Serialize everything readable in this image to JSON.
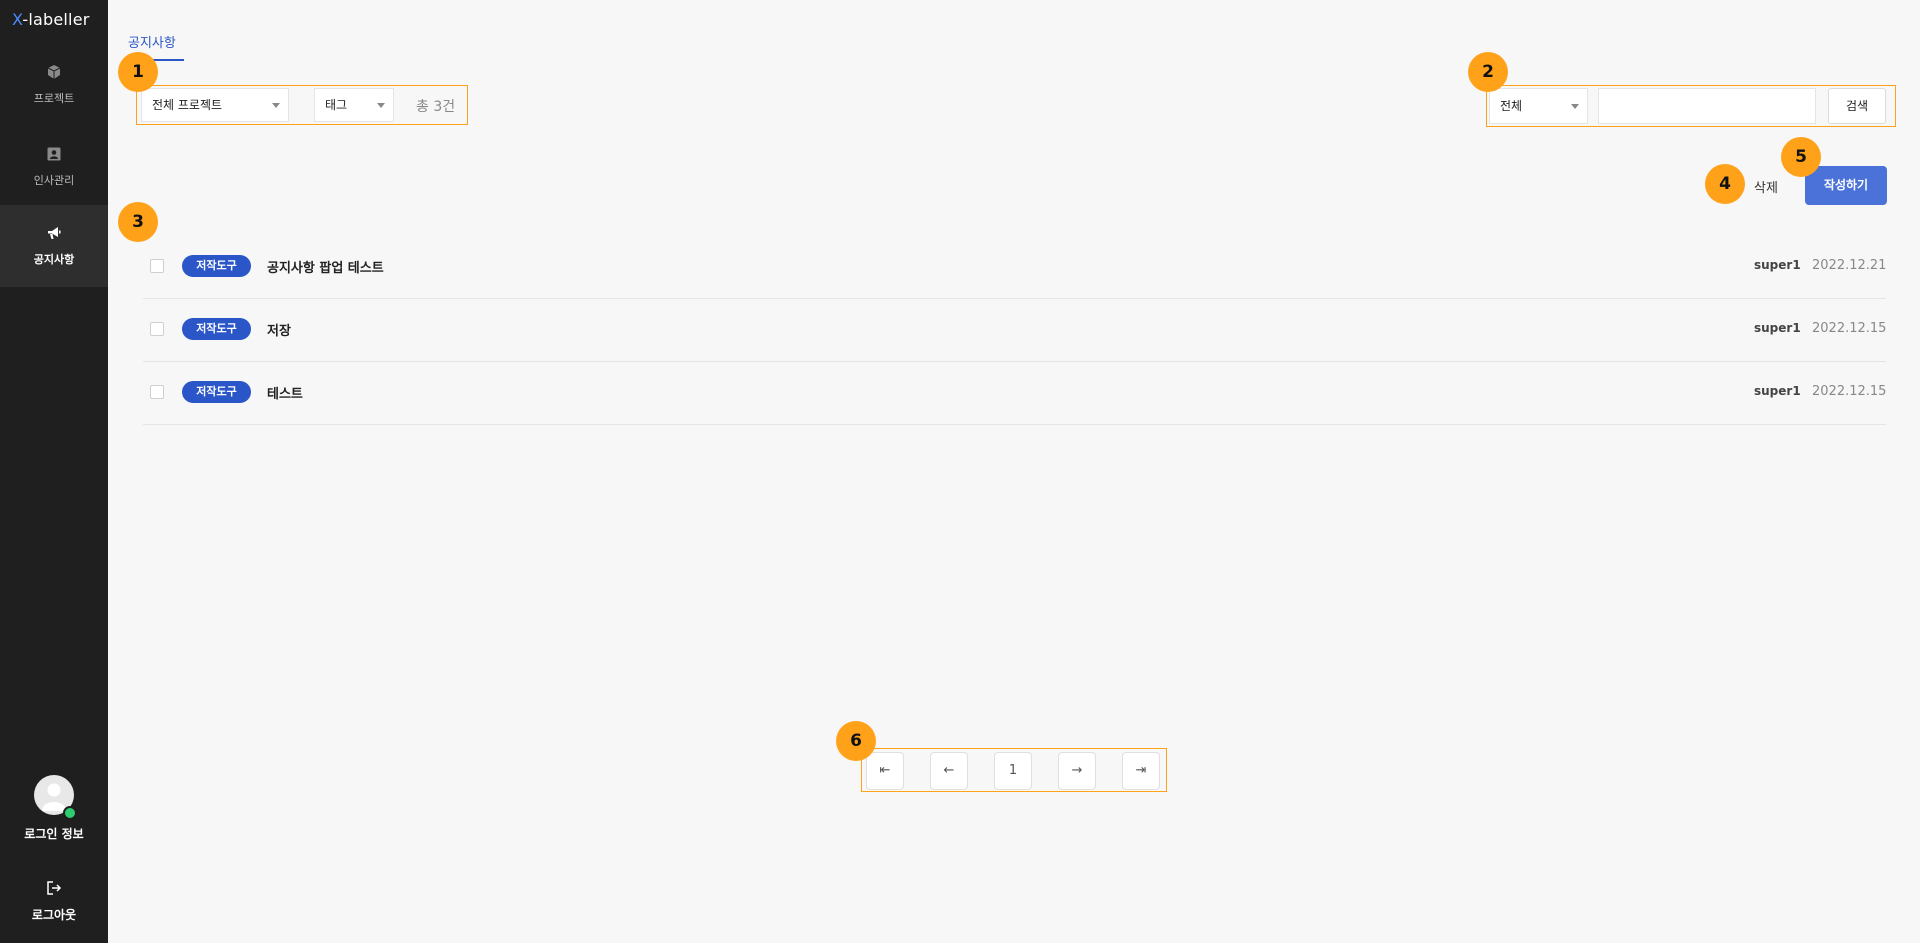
{
  "app": {
    "logo_x": "X",
    "logo_rest": "-labeller"
  },
  "sidebar": {
    "items": [
      {
        "label": "프로젝트",
        "icon": "cube-icon"
      },
      {
        "label": "인사관리",
        "icon": "person-card-icon"
      },
      {
        "label": "공지사항",
        "icon": "megaphone-icon"
      }
    ],
    "profile_label": "로그인 정보",
    "logout_label": "로그아웃"
  },
  "tab": {
    "label": "공지사항"
  },
  "filters": {
    "project_select": "전체 프로젝트",
    "tag_select": "태그",
    "total": "총 3건"
  },
  "search": {
    "scope_select": "전체",
    "input_value": "",
    "button_label": "검색"
  },
  "actions": {
    "delete_label": "삭제",
    "write_label": "작성하기"
  },
  "notices": [
    {
      "tag": "저작도구",
      "title": "공지사항 팝업 테스트",
      "author": "super1",
      "date": "2022.12.21"
    },
    {
      "tag": "저작도구",
      "title": "저장",
      "author": "super1",
      "date": "2022.12.15"
    },
    {
      "tag": "저작도구",
      "title": "테스트",
      "author": "super1",
      "date": "2022.12.15"
    }
  ],
  "pagination": {
    "first": "⇤",
    "prev": "←",
    "current": "1",
    "next": "→",
    "last": "⇥"
  },
  "callouts": [
    "1",
    "2",
    "3",
    "4",
    "5",
    "6"
  ],
  "colors": {
    "accent": "#2b56c8",
    "callout": "#ffa21a",
    "sidebar": "#1f1f1f",
    "button": "#4a72d8"
  }
}
